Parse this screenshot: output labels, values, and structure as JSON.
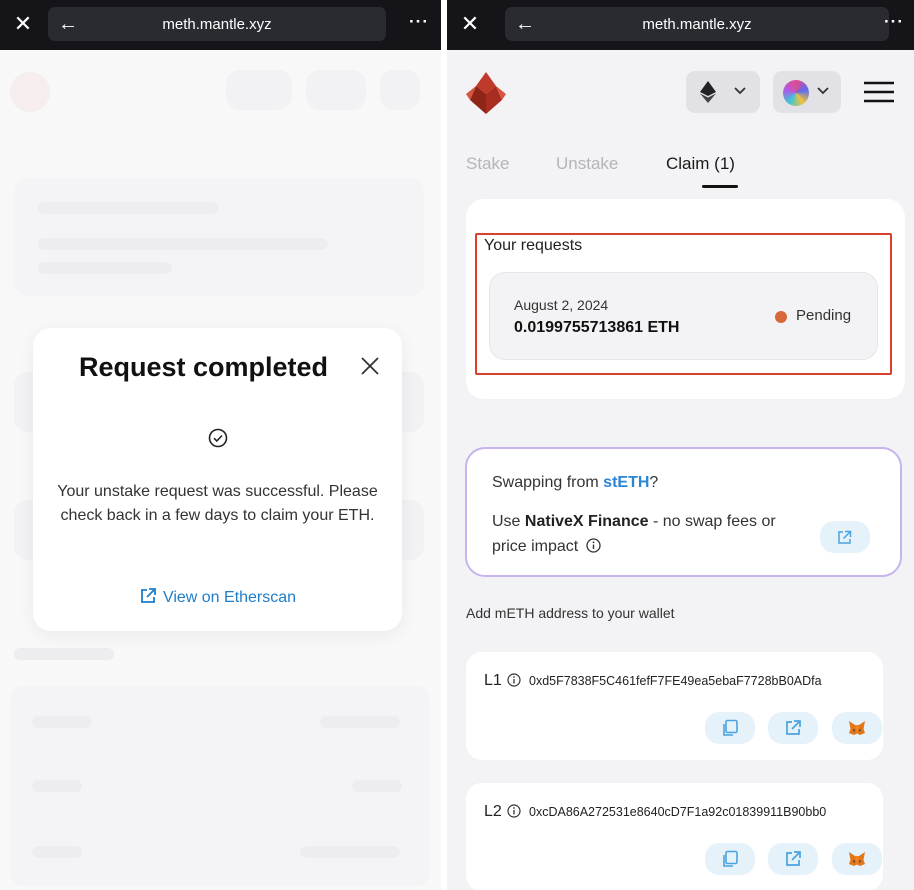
{
  "browser": {
    "url": "meth.mantle.xyz",
    "close_icon": "close-icon",
    "back_icon": "arrow-left-icon",
    "more_icon": "more-icon"
  },
  "left_modal": {
    "title": "Request completed",
    "message": "Your unstake request was successful. Please check back in a few days to claim your ETH.",
    "link_label": "View on Etherscan"
  },
  "header": {
    "network_icon": "ethereum-icon",
    "account_icon": "avatar"
  },
  "tabs": [
    {
      "label": "Stake",
      "active": false
    },
    {
      "label": "Unstake",
      "active": false
    },
    {
      "label": "Claim (1)",
      "active": true
    }
  ],
  "requests": {
    "title": "Your requests",
    "items": [
      {
        "date": "August 2, 2024",
        "amount": "0.0199755713861 ETH",
        "status": "Pending"
      }
    ]
  },
  "swap_banner": {
    "question_prefix": "Swapping from ",
    "question_token": "stETH",
    "question_suffix": "?",
    "line_prefix": "Use ",
    "line_brand": "NativeX Finance",
    "line_suffix": " - no swap fees or price impact"
  },
  "wallet": {
    "title": "Add mETH address to your wallet",
    "addresses": [
      {
        "label": "L1",
        "address": "0xd5F7838F5C461fefF7FE49ea5ebaF7728bB0ADfa"
      },
      {
        "label": "L2",
        "address": "0xcDA86A272531e8640cD7F1a92c01839911B90bb0"
      }
    ]
  },
  "colors": {
    "accent": "#2b86d6",
    "highlight_border": "#d8402a",
    "pending": "#d9673a",
    "topbar": "#141419"
  }
}
